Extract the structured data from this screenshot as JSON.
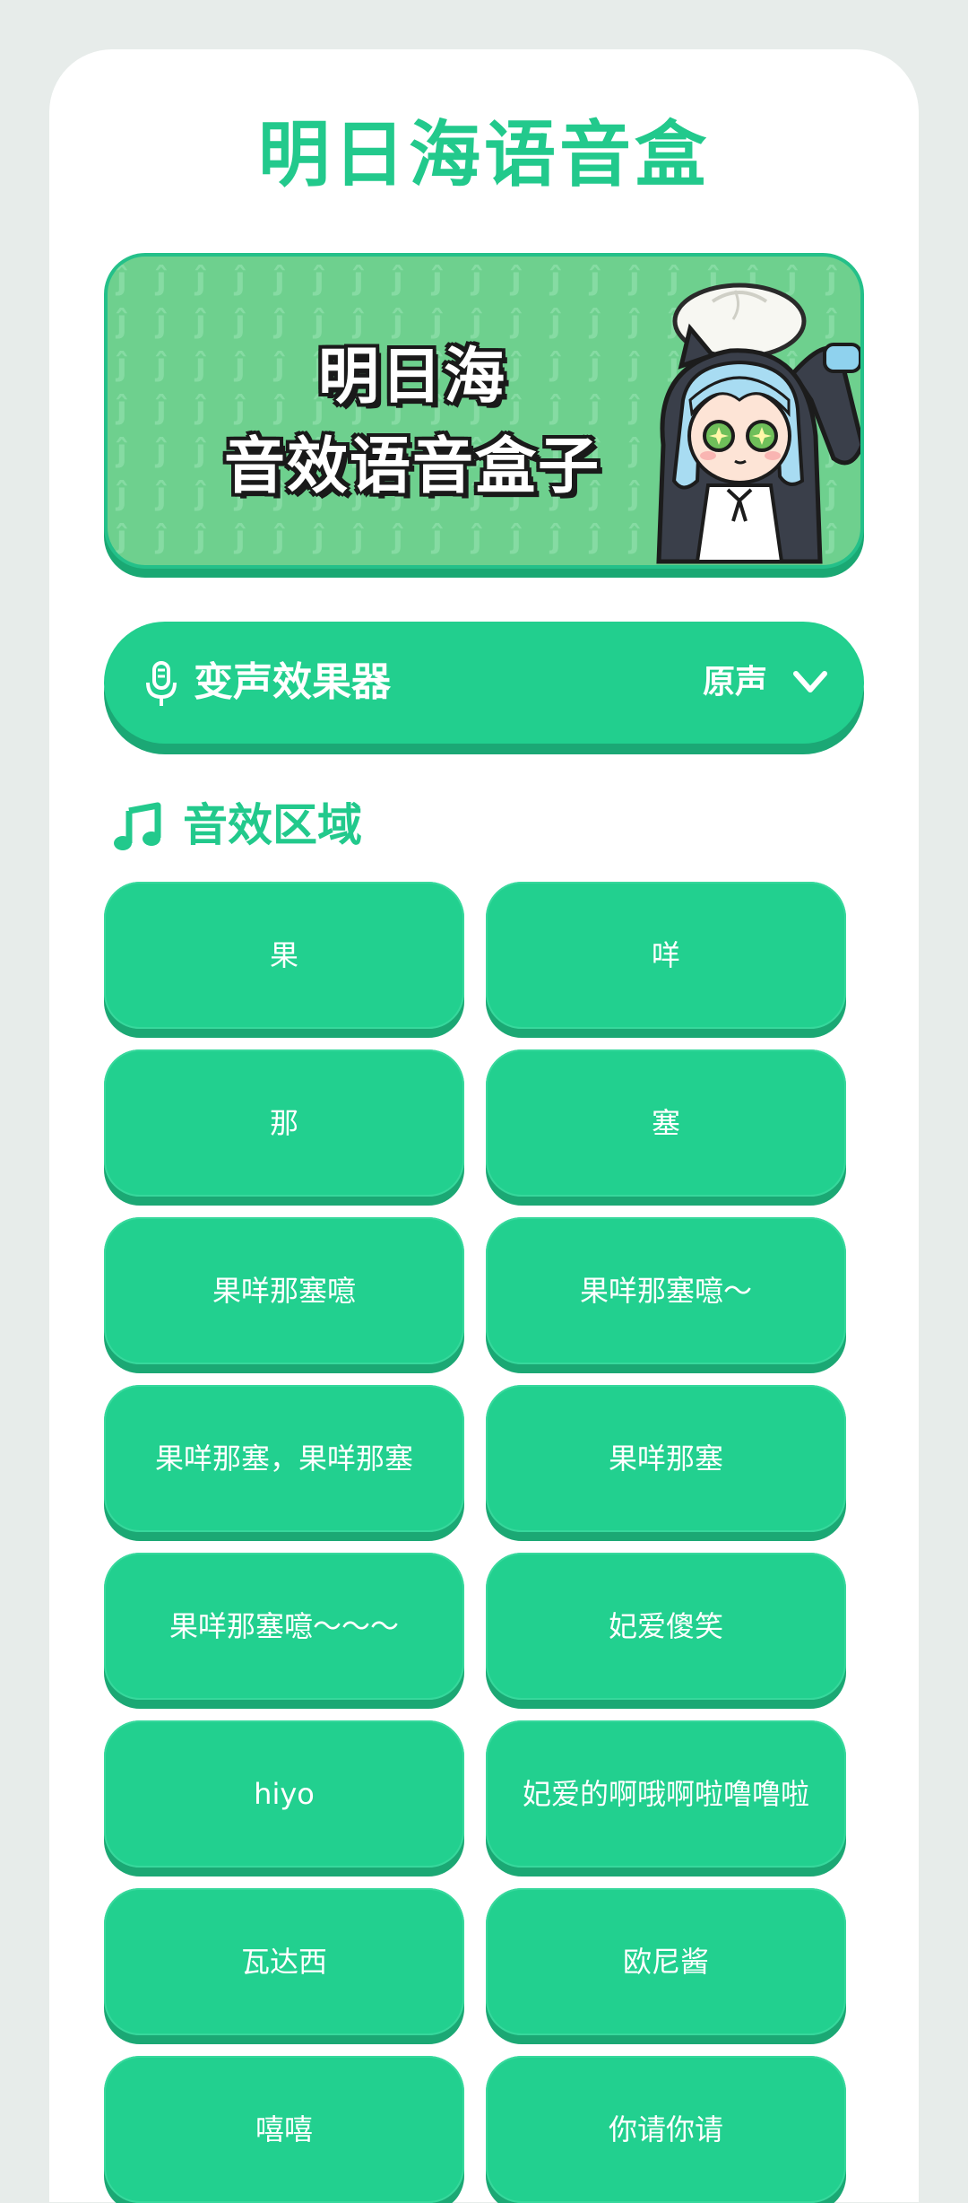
{
  "app": {
    "title": "明日海语音盒"
  },
  "banner": {
    "line1": "明日海",
    "line2": "音效语音盒子"
  },
  "voice_changer": {
    "label": "变声效果器",
    "selected": "原声"
  },
  "section": {
    "title": "音效区域"
  },
  "sounds": [
    "果",
    "咩",
    "那",
    "塞",
    "果咩那塞噫",
    "果咩那塞噫～",
    "果咩那塞，果咩那塞",
    "果咩那塞",
    "果咩那塞噫～～～",
    "妃爱傻笑",
    "hiyo",
    "妃爱的啊哦啊啦噜噜啦",
    "瓦达西",
    "欧尼酱",
    "嘻嘻",
    "你请你请"
  ],
  "colors": {
    "accent": "#22c98c",
    "button": "#22d08f",
    "button_shadow": "#1ba874",
    "banner_bg": "#6ed08e",
    "page_bg": "#e7ecea"
  },
  "icons": {
    "voice_changer": "microphone-icon",
    "dropdown": "chevron-down-icon",
    "section": "music-note-icon"
  }
}
